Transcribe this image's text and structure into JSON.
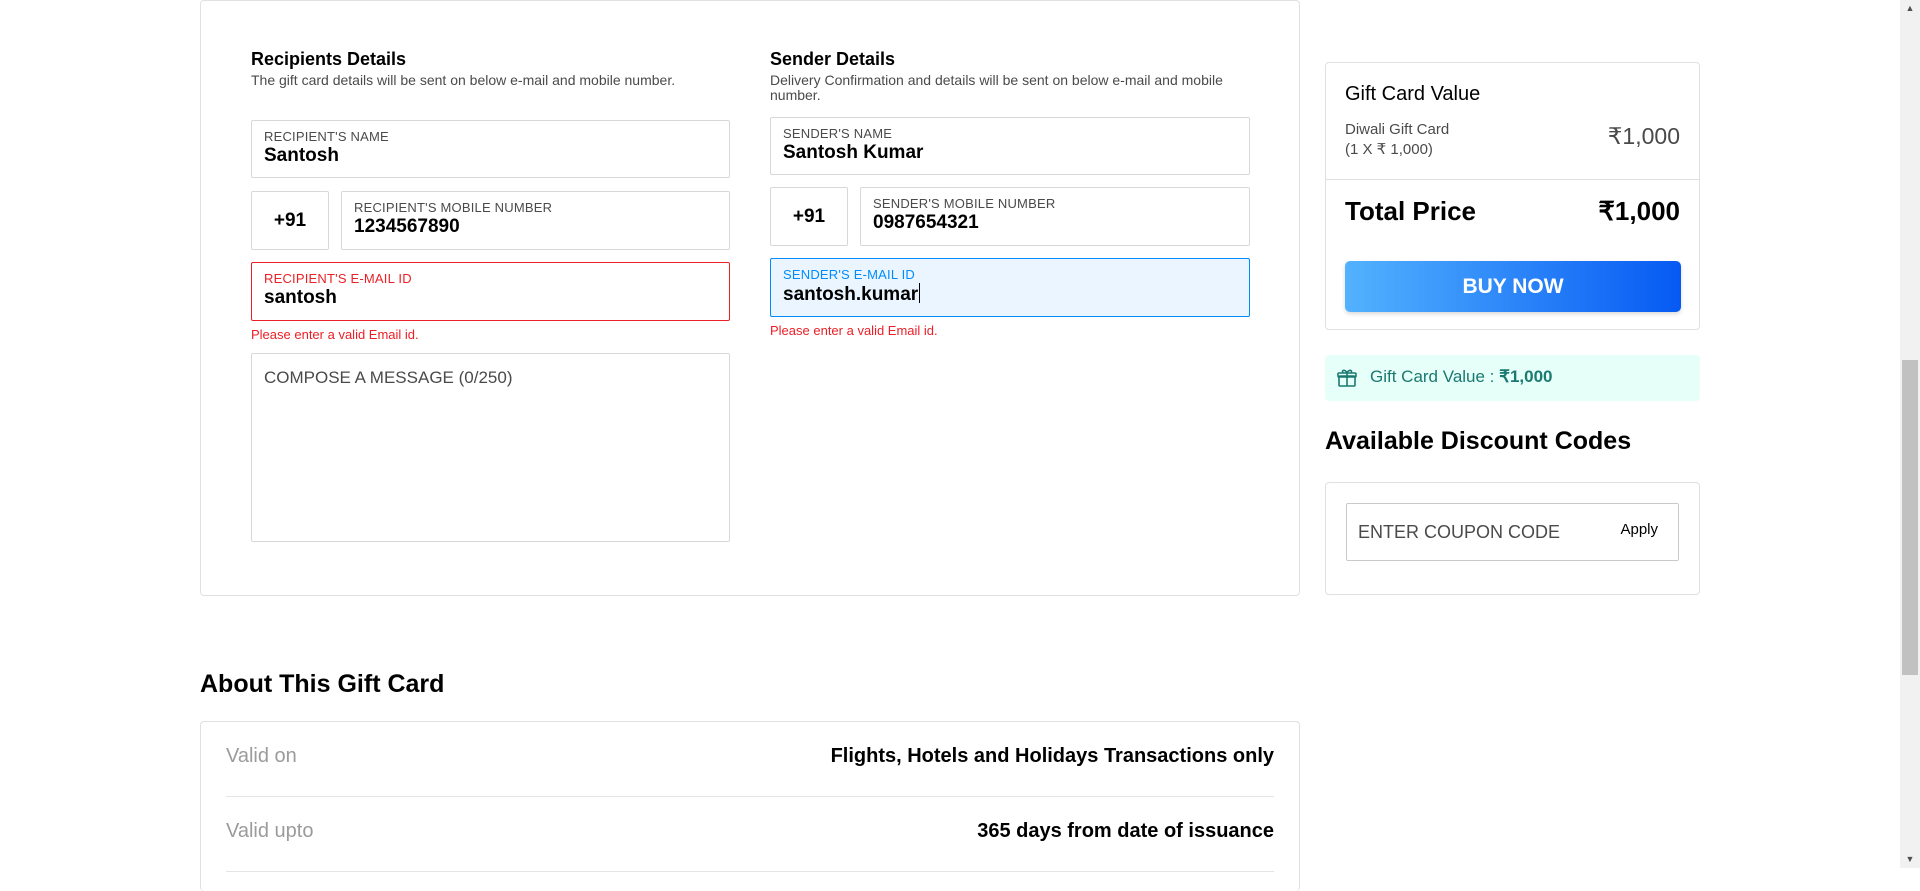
{
  "recipient": {
    "title": "Recipients Details",
    "subtitle": "The gift card details will be sent on below e-mail and mobile number.",
    "name_label": "RECIPIENT'S NAME",
    "name_value": "Santosh",
    "country_code": "+91",
    "mobile_label": "RECIPIENT'S MOBILE NUMBER",
    "mobile_value": "1234567890",
    "email_label": "RECIPIENT'S E-MAIL ID",
    "email_value": "santosh",
    "email_error": "Please enter a valid Email id.",
    "message_placeholder": "COMPOSE A MESSAGE (0/250)"
  },
  "sender": {
    "title": "Sender Details",
    "subtitle_line1": "Delivery Confirmation and details will be sent on below e-mail and mobile",
    "subtitle_line2": "number.",
    "name_label": "SENDER'S NAME",
    "name_value": "Santosh Kumar",
    "country_code": "+91",
    "mobile_label": "SENDER'S MOBILE NUMBER",
    "mobile_value": "0987654321",
    "email_label": "SENDER'S E-MAIL ID",
    "email_value": "santosh.kumar",
    "email_error": "Please enter a valid Email id."
  },
  "summary": {
    "title": "Gift Card Value",
    "item_name": "Diwali Gift Card",
    "item_qty": "(1 X ₹ 1,000)",
    "item_amount": "₹1,000",
    "total_label": "Total Price",
    "total_amount": "₹1,000",
    "buy_label": "BUY NOW"
  },
  "gift_value_bar": {
    "label": "Gift Card Value : ",
    "amount": "₹1,000",
    "icon": "gift-icon"
  },
  "discounts": {
    "title": "Available Discount Codes",
    "coupon_placeholder": "ENTER COUPON CODE",
    "apply_label": "Apply"
  },
  "about": {
    "title": "About This Gift Card",
    "rows": [
      {
        "key": "Valid on",
        "value": "Flights, Hotels and Holidays Transactions only"
      },
      {
        "key": "Valid upto",
        "value": "365 days from date of issuance"
      }
    ]
  },
  "colors": {
    "error": "#eb2026",
    "focus": "#008cff",
    "buy_gradient_start": "#53b2fe",
    "buy_gradient_end": "#065af3",
    "value_bar_bg": "#e6fff9"
  }
}
